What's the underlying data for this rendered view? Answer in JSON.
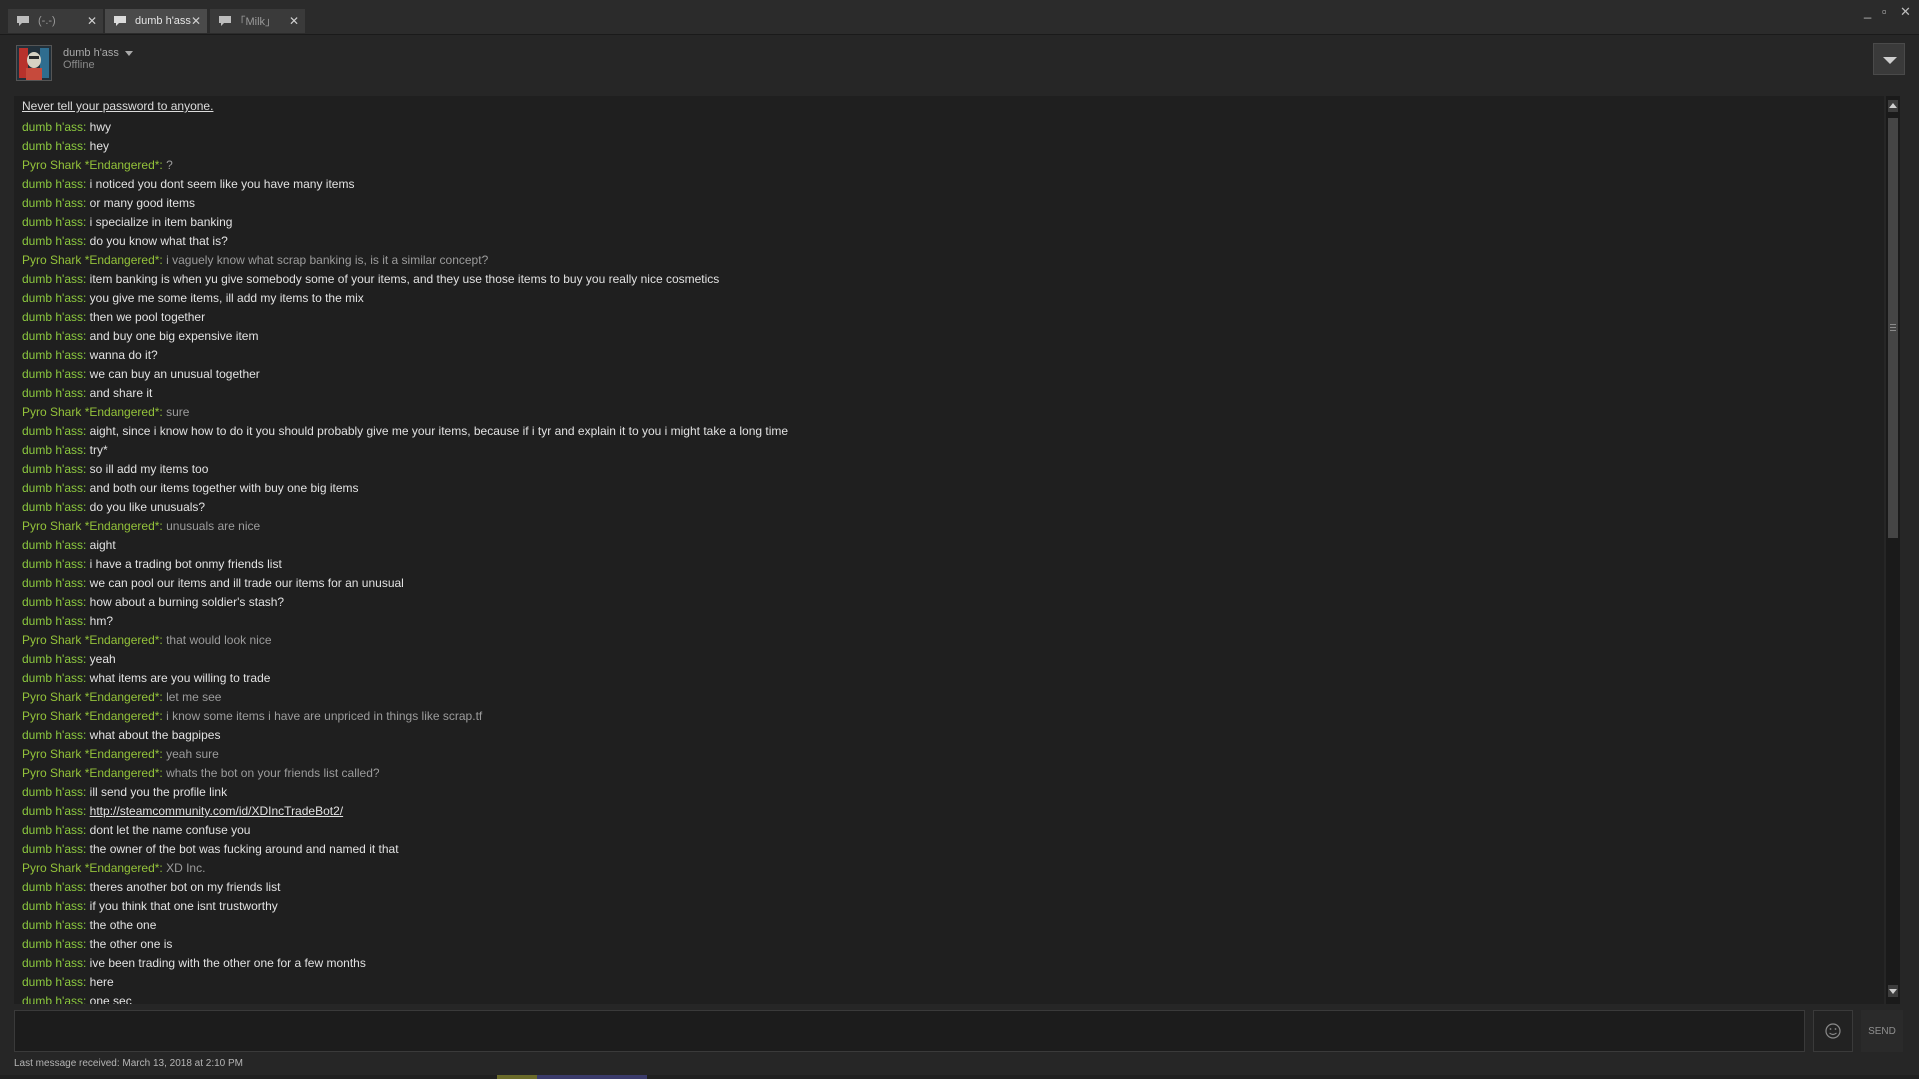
{
  "tabs": [
    {
      "label": "(-.-)"
    },
    {
      "label": "dumb h'ass"
    },
    {
      "label": "｢Milk｣"
    }
  ],
  "window_controls": {
    "minimize": "_",
    "maximize": "▫",
    "close": "✕"
  },
  "header": {
    "name": "dumb h'ass",
    "status": "Offline"
  },
  "notice": "Never tell your password to anyone.",
  "messages": [
    {
      "from": "dumb h'ass",
      "text": "hwy"
    },
    {
      "from": "dumb h'ass",
      "text": "hey"
    },
    {
      "from": "Pyro Shark *Endangered*",
      "text": "?"
    },
    {
      "from": "dumb h'ass",
      "text": "i noticed you dont seem like you have many items"
    },
    {
      "from": "dumb h'ass",
      "text": "or many good items"
    },
    {
      "from": "dumb h'ass",
      "text": "i specialize in item banking"
    },
    {
      "from": "dumb h'ass",
      "text": "do you know what that is?"
    },
    {
      "from": "Pyro Shark *Endangered*",
      "text": "i vaguely know what scrap banking is, is it a similar concept?"
    },
    {
      "from": "dumb h'ass",
      "text": "item banking is when yu give somebody some of your items, and they use those items to buy you really nice cosmetics"
    },
    {
      "from": "dumb h'ass",
      "text": "you give me some items, ill add my items to the mix"
    },
    {
      "from": "dumb h'ass",
      "text": "then we pool together"
    },
    {
      "from": "dumb h'ass",
      "text": "and buy one big expensive item"
    },
    {
      "from": "dumb h'ass",
      "text": "wanna do it?"
    },
    {
      "from": "dumb h'ass",
      "text": "we can buy an unusual together"
    },
    {
      "from": "dumb h'ass",
      "text": "and share it"
    },
    {
      "from": "Pyro Shark *Endangered*",
      "text": "sure"
    },
    {
      "from": "dumb h'ass",
      "text": "aight, since i know how to do it you should probably give me your items, because if i tyr and explain it to you i might take a long time"
    },
    {
      "from": "dumb h'ass",
      "text": "try*"
    },
    {
      "from": "dumb h'ass",
      "text": "so ill add my items too"
    },
    {
      "from": "dumb h'ass",
      "text": "and both our items together with buy one big items"
    },
    {
      "from": "dumb h'ass",
      "text": "do you like unusuals?"
    },
    {
      "from": "Pyro Shark *Endangered*",
      "text": "unusuals are nice"
    },
    {
      "from": "dumb h'ass",
      "text": "aight"
    },
    {
      "from": "dumb h'ass",
      "text": "i have a trading bot onmy friends list"
    },
    {
      "from": "dumb h'ass",
      "text": "we can pool our items and ill trade our items for an unusual"
    },
    {
      "from": "dumb h'ass",
      "text": "how about a burning soldier's stash?"
    },
    {
      "from": "dumb h'ass",
      "text": "hm?"
    },
    {
      "from": "Pyro Shark *Endangered*",
      "text": "that would look nice"
    },
    {
      "from": "dumb h'ass",
      "text": "yeah"
    },
    {
      "from": "dumb h'ass",
      "text": "what items are you willing to trade"
    },
    {
      "from": "Pyro Shark *Endangered*",
      "text": "let me see"
    },
    {
      "from": "Pyro Shark *Endangered*",
      "text": "i know some items i have are unpriced in things like scrap.tf"
    },
    {
      "from": "dumb h'ass",
      "text": "what about the bagpipes"
    },
    {
      "from": "Pyro Shark *Endangered*",
      "text": "yeah sure"
    },
    {
      "from": "Pyro Shark *Endangered*",
      "text": "whats the bot on your friends list called?"
    },
    {
      "from": "dumb h'ass",
      "text": "ill send you the profile link"
    },
    {
      "from": "dumb h'ass",
      "text": "http://steamcommunity.com/id/XDIncTradeBot2/"
    },
    {
      "from": "dumb h'ass",
      "text": "dont let the name confuse you"
    },
    {
      "from": "dumb h'ass",
      "text": "the owner of the bot was fucking around and named it that"
    },
    {
      "from": "Pyro Shark *Endangered*",
      "text": "XD Inc."
    },
    {
      "from": "dumb h'ass",
      "text": "theres another bot on my friends list"
    },
    {
      "from": "dumb h'ass",
      "text": "if you think that one isnt trustworthy"
    },
    {
      "from": "dumb h'ass",
      "text": "the othe one"
    },
    {
      "from": "dumb h'ass",
      "text": "the other one is"
    },
    {
      "from": "dumb h'ass",
      "text": "ive been trading with the other one for a few months"
    },
    {
      "from": "dumb h'ass",
      "text": "here"
    },
    {
      "from": "dumb h'ass",
      "text": "one sec"
    }
  ],
  "input": {
    "placeholder": ""
  },
  "send_label": "SEND",
  "footer": "Last message received: March 13, 2018 at 2:10 PM",
  "colors": {
    "name_green": "#8cc93f",
    "background": "#262626",
    "chat_bg": "#1f1f1f"
  },
  "icons": {
    "tab": "chat-bubble-icon",
    "emoji": "smiley-icon",
    "menu": "dropdown-triangle-icon"
  }
}
